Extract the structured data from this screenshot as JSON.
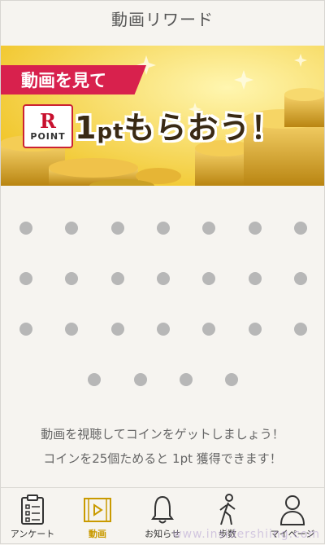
{
  "header": {
    "title": "動画リワード"
  },
  "banner": {
    "ribbon_text": "動画を見て",
    "badge_letter": "R",
    "badge_text": "POINT",
    "headline_num": "1",
    "headline_unit": "pt",
    "headline_rest": "もらおう！"
  },
  "coins": {
    "total": 25,
    "collected": 0
  },
  "message": {
    "line1": "動画を視聴してコインをゲットしましょう！",
    "line2": "コインを25個ためると 1pt 獲得できます！"
  },
  "tabs": [
    {
      "label": "アンケート",
      "icon": "clipboard-icon",
      "active": false
    },
    {
      "label": "動画",
      "icon": "video-icon",
      "active": true
    },
    {
      "label": "お知らせ",
      "icon": "bell-icon",
      "active": false
    },
    {
      "label": "歩数",
      "icon": "walking-icon",
      "active": false
    },
    {
      "label": "マイページ",
      "icon": "person-icon",
      "active": false
    }
  ],
  "watermark": "www.insidershiing.com",
  "colors": {
    "accent": "#c99a00",
    "ribbon": "#d8214d",
    "banner": "#f5cf3a",
    "dot": "#b7b7b7"
  }
}
